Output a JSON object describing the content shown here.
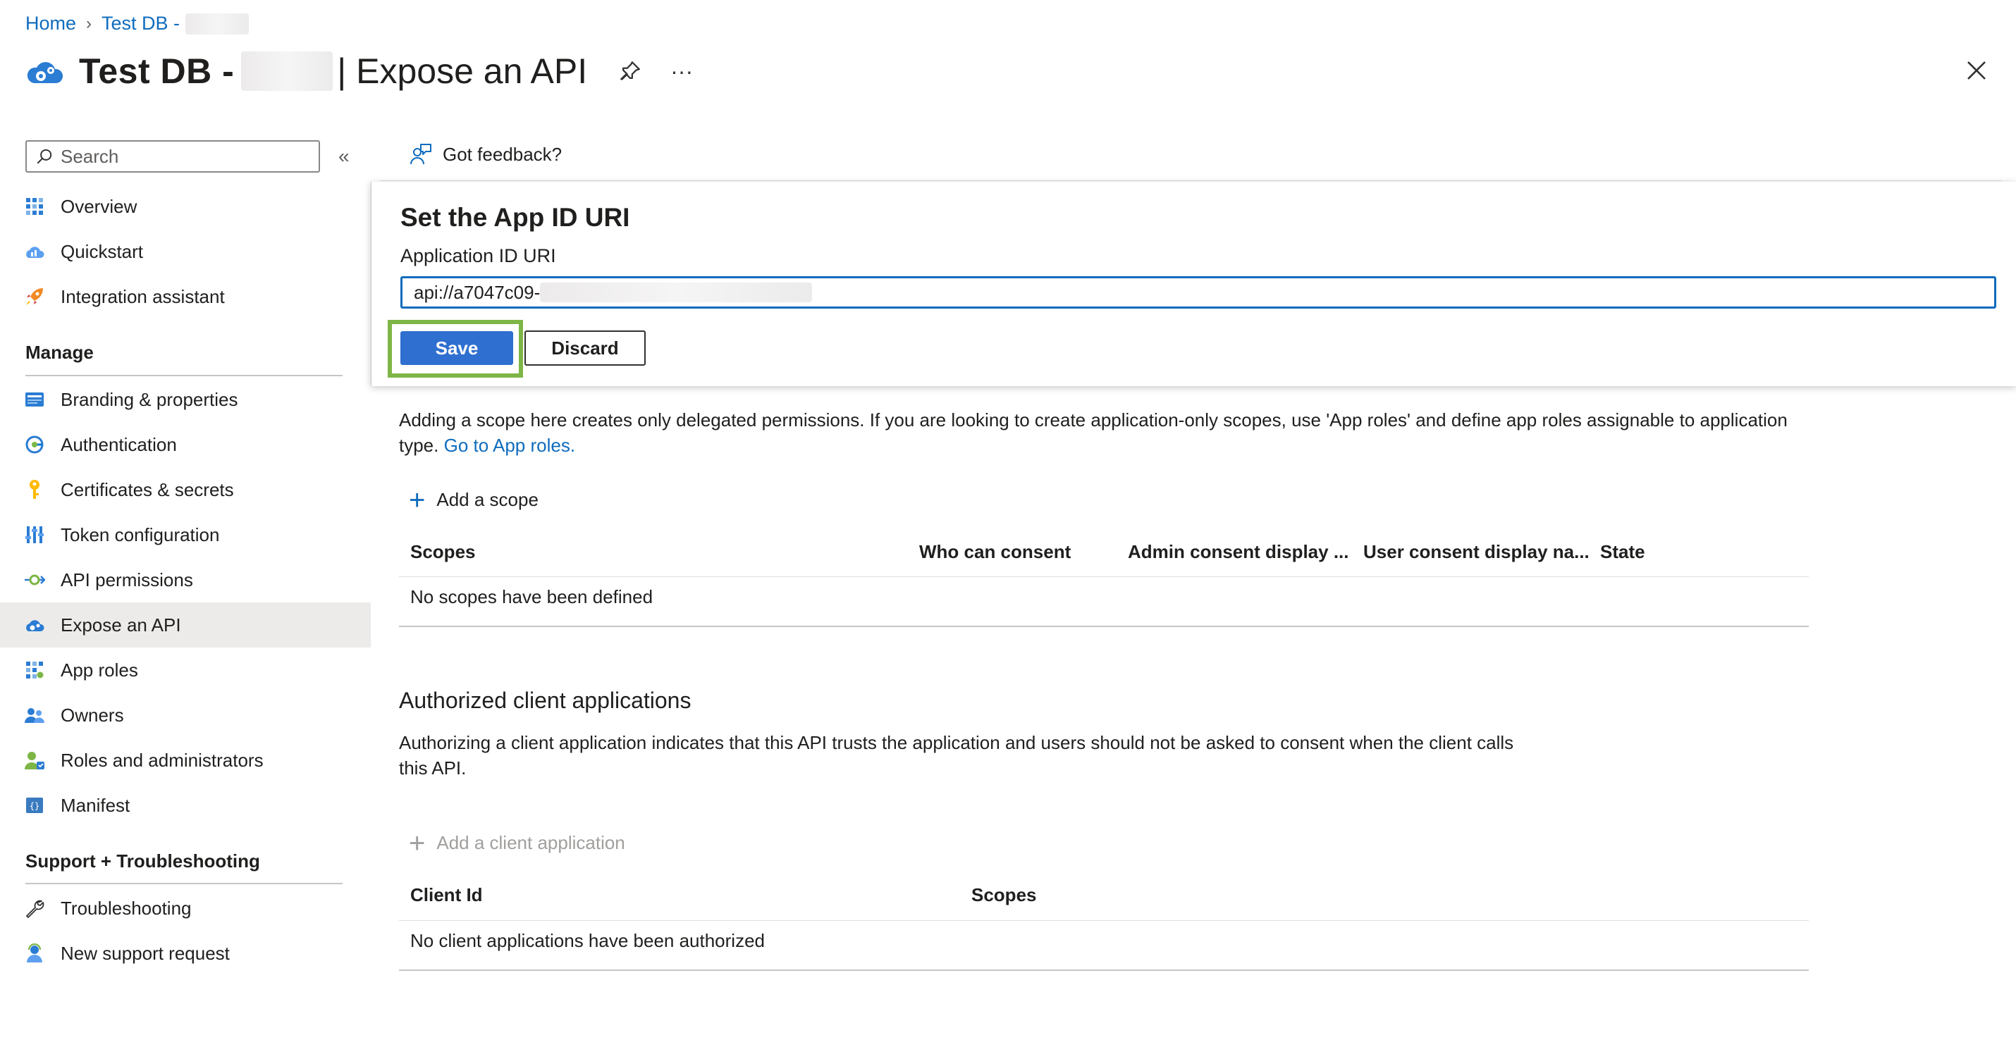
{
  "breadcrumb": {
    "home": "Home",
    "current": "Test DB -"
  },
  "header": {
    "title": "Test DB -",
    "subtitle": "| Expose an API",
    "more": "···"
  },
  "sidebar": {
    "search_placeholder": "Search",
    "collapse": "«",
    "top_items": [
      {
        "label": "Overview",
        "icon": "overview-grid-icon"
      },
      {
        "label": "Quickstart",
        "icon": "quickstart-cloud-icon"
      },
      {
        "label": "Integration assistant",
        "icon": "rocket-icon"
      }
    ],
    "manage_heading": "Manage",
    "manage_items": [
      {
        "label": "Branding & properties",
        "icon": "branding-icon"
      },
      {
        "label": "Authentication",
        "icon": "authentication-icon"
      },
      {
        "label": "Certificates & secrets",
        "icon": "key-icon"
      },
      {
        "label": "Token configuration",
        "icon": "token-bars-icon"
      },
      {
        "label": "API permissions",
        "icon": "api-permissions-icon"
      },
      {
        "label": "Expose an API",
        "icon": "expose-api-cloud-icon",
        "active": true
      },
      {
        "label": "App roles",
        "icon": "app-roles-grid-icon"
      },
      {
        "label": "Owners",
        "icon": "owners-people-icon"
      },
      {
        "label": "Roles and administrators",
        "icon": "roles-admin-icon"
      },
      {
        "label": "Manifest",
        "icon": "manifest-icon"
      }
    ],
    "support_heading": "Support + Troubleshooting",
    "support_items": [
      {
        "label": "Troubleshooting",
        "icon": "wrench-icon"
      },
      {
        "label": "New support request",
        "icon": "support-person-icon"
      }
    ]
  },
  "toolbar": {
    "feedback": "Got feedback?"
  },
  "panel": {
    "title": "Set the App ID URI",
    "label": "Application ID URI",
    "value": "api://a7047c09-",
    "save": "Save",
    "discard": "Discard"
  },
  "scopes": {
    "description": "Adding a scope here creates only delegated permissions. If you are looking to create application-only scopes, use 'App roles' and define app roles assignable to application type.",
    "link": "Go to App roles.",
    "add": "Add a scope",
    "columns": [
      "Scopes",
      "Who can consent",
      "Admin consent display ...",
      "User consent display na...",
      "State"
    ],
    "empty": "No scopes have been defined"
  },
  "clients": {
    "heading": "Authorized client applications",
    "description": "Authorizing a client application indicates that this API trusts the application and users should not be asked to consent when the client calls this API.",
    "add": "Add a client application",
    "columns": [
      "Client Id",
      "Scopes"
    ],
    "empty": "No client applications have been authorized"
  },
  "colors": {
    "accent": "#0f6cbd",
    "save_button": "#2f6fcf",
    "highlight": "#7db646",
    "active_nav": "#edebe9"
  }
}
